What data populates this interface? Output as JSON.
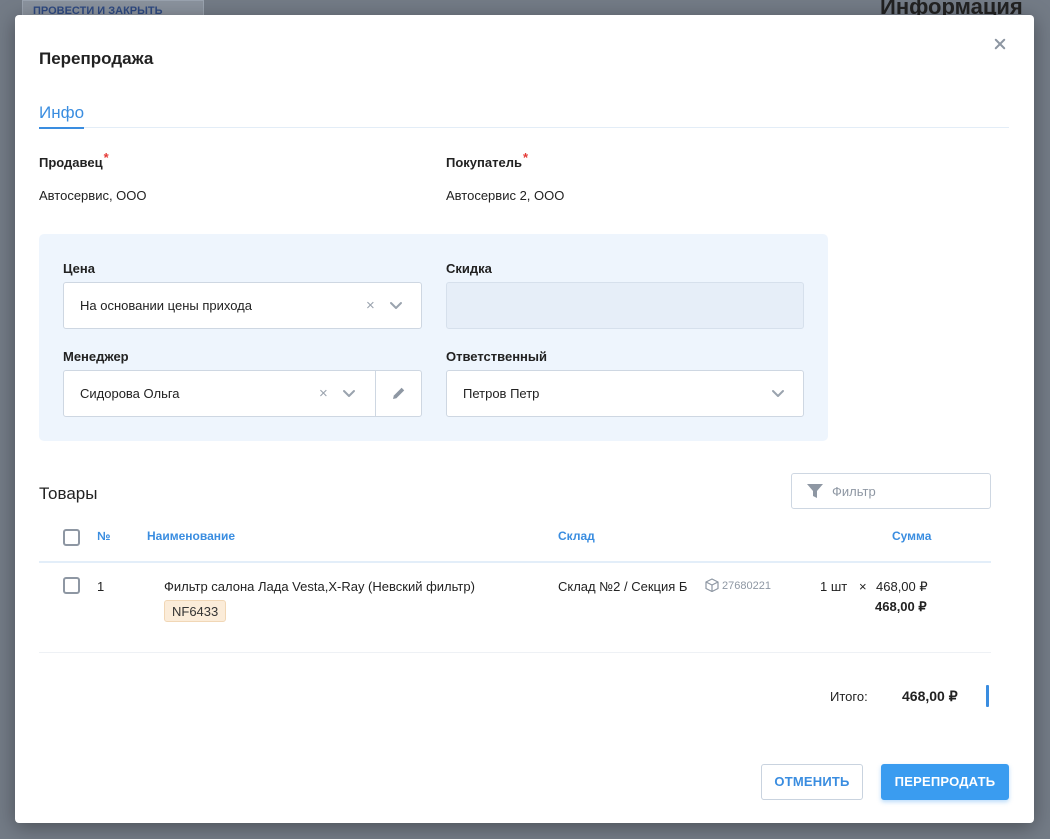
{
  "background": {
    "button_label": "ПРОВЕСТИ И ЗАКРЫТЬ",
    "title": "Информация"
  },
  "modal": {
    "title": "Перепродажа",
    "tabs": [
      {
        "label": "Инфо",
        "active": true
      }
    ],
    "seller": {
      "label": "Продавец",
      "required_mark": "*",
      "value": "Автосервис, ООО"
    },
    "buyer": {
      "label": "Покупатель",
      "required_mark": "*",
      "value": "Автосервис 2, ООО"
    },
    "price": {
      "label": "Цена",
      "value": "На основании цены прихода"
    },
    "discount": {
      "label": "Скидка",
      "value": ""
    },
    "manager": {
      "label": "Менеджер",
      "value": "Сидорова Ольга"
    },
    "responsible": {
      "label": "Ответственный",
      "value": "Петров Петр"
    },
    "clear_glyph": "×"
  },
  "goods": {
    "title": "Товары",
    "filter_placeholder": "Фильтр",
    "columns": {
      "number": "№",
      "name": "Наименование",
      "warehouse": "Склад",
      "sum": "Сумма"
    },
    "rows": [
      {
        "number": "1",
        "name": "Фильтр салона Лада Vesta,X-Ray (Невский фильтр)",
        "article": "NF6433",
        "warehouse": "Склад №2 / Секция Б",
        "code": "27680221",
        "qty": "1 шт",
        "times": "×",
        "price": "468,00 ₽",
        "sum": "468,00 ₽"
      }
    ],
    "total_label": "Итого:",
    "total_value": "468,00 ₽"
  },
  "actions": {
    "cancel": "ОТМЕНИТЬ",
    "resell": "ПЕРЕПРОДАТЬ"
  },
  "colors": {
    "accent": "#3a8de0",
    "required": "#e53935",
    "panel": "#eef5fd",
    "badge": "#fbecd9"
  }
}
